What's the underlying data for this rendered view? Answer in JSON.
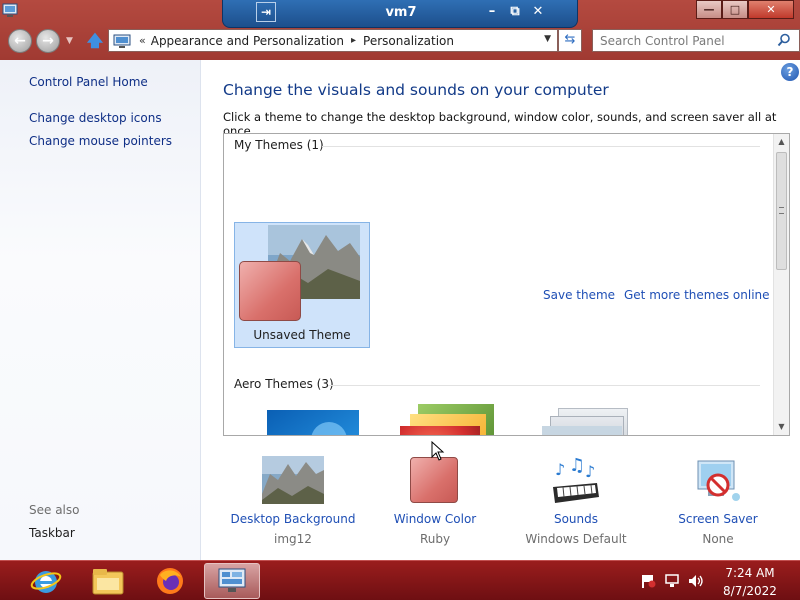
{
  "vm_bar": {
    "title": "vm7"
  },
  "window": {
    "minimize_symbol": "—",
    "maximize_symbol": "□",
    "close_symbol": "✕"
  },
  "address": {
    "chevron": "«",
    "segments": [
      "Appearance and Personalization",
      "Personalization"
    ],
    "separator": "▸"
  },
  "search": {
    "placeholder": "Search Control Panel"
  },
  "sidebar": {
    "home": "Control Panel Home",
    "links": [
      "Change desktop icons",
      "Change mouse pointers"
    ],
    "see_also_label": "See also",
    "see_also": [
      "Taskbar"
    ]
  },
  "main": {
    "title": "Change the visuals and sounds on your computer",
    "description": "Click a theme to change the desktop background, window color, sounds, and screen saver all at once.",
    "help_symbol": "?",
    "my_themes": {
      "heading": "My Themes (1)",
      "themes": [
        {
          "name": "Unsaved Theme",
          "selected": true
        }
      ]
    },
    "actions": {
      "save_theme": "Save theme",
      "get_more": "Get more themes online"
    },
    "aero_themes": {
      "heading": "Aero Themes (3)"
    }
  },
  "bottom": {
    "items": [
      {
        "link": "Desktop Background",
        "value": "img12",
        "icon": "landscape-thumbnail-icon"
      },
      {
        "link": "Window Color",
        "value": "Ruby",
        "icon": "color-swatch-icon"
      },
      {
        "link": "Sounds",
        "value": "Windows Default",
        "icon": "music-keyboard-icon"
      },
      {
        "link": "Screen Saver",
        "value": "None",
        "icon": "screen-saver-icon"
      }
    ]
  },
  "taskbar": {
    "apps": [
      "internet-explorer-icon",
      "file-explorer-icon",
      "firefox-icon",
      "control-panel-icon"
    ],
    "time": "7:24 AM",
    "date": "8/7/2022"
  },
  "colors": {
    "frame": "#a0372f",
    "link": "#1f4fb5",
    "title": "#123a88",
    "window_color_ruby": "#d9706b"
  }
}
